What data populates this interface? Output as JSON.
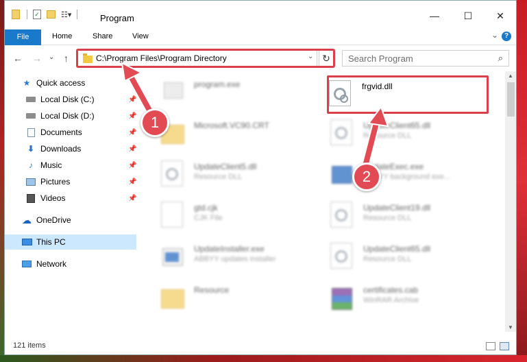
{
  "window": {
    "title": "Program",
    "minimize_glyph": "—",
    "maximize_glyph": "☐",
    "close_glyph": "✕"
  },
  "ribbon": {
    "tabs": [
      "File",
      "Home",
      "Share",
      "View"
    ],
    "expand_glyph": "⌄",
    "help_glyph": "?"
  },
  "address": {
    "path": "C:\\Program Files\\Program Directory",
    "refresh_glyph": "↻"
  },
  "search": {
    "placeholder": "Search Program"
  },
  "nav": {
    "back_glyph": "←",
    "forward_glyph": "→",
    "recent_glyph": "⌄",
    "up_glyph": "↑"
  },
  "sidebar": {
    "items": [
      {
        "label": "Quick access",
        "icon": "star-icon",
        "pinned": false
      },
      {
        "label": "Local Disk (C:)",
        "icon": "drive-icon",
        "pinned": true
      },
      {
        "label": "Local Disk (D:)",
        "icon": "drive-icon",
        "pinned": true
      },
      {
        "label": "Documents",
        "icon": "documents-icon",
        "pinned": true
      },
      {
        "label": "Downloads",
        "icon": "download-icon",
        "pinned": true
      },
      {
        "label": "Music",
        "icon": "music-icon",
        "pinned": true
      },
      {
        "label": "Pictures",
        "icon": "pictures-icon",
        "pinned": true
      },
      {
        "label": "Videos",
        "icon": "videos-icon",
        "pinned": true
      },
      {
        "label": "OneDrive",
        "icon": "cloud-icon",
        "pinned": false
      },
      {
        "label": "This PC",
        "icon": "computer-icon",
        "pinned": false,
        "selected": true
      },
      {
        "label": "Network",
        "icon": "network-icon",
        "pinned": false
      }
    ],
    "pin_glyph": "📌"
  },
  "files": [
    {
      "name": "program.exe",
      "desc": "",
      "icon": "exe-icon"
    },
    {
      "name": "frgvid.dll",
      "desc": "",
      "icon": "dll-icon",
      "highlighted": true
    },
    {
      "name": "Microsoft.VC90.CRT",
      "desc": "",
      "icon": "folder-icon"
    },
    {
      "name": "UpdateClient65.dll",
      "desc": "Resource DLL",
      "icon": "dll-icon"
    },
    {
      "name": "UpdateClient5.dll",
      "desc": "Resource DLL",
      "icon": "dll-icon"
    },
    {
      "name": "UpdateExec.exe",
      "desc": "ABBYY background exe...",
      "icon": "exe-icon"
    },
    {
      "name": "gtd.cjk",
      "desc": "CJK File",
      "icon": "file-icon"
    },
    {
      "name": "UpdateClient19.dll",
      "desc": "Resource DLL",
      "icon": "dll-icon"
    },
    {
      "name": "UpdateInstaller.exe",
      "desc": "ABBYY updates installer",
      "icon": "exe-icon"
    },
    {
      "name": "UpdateClient65.dll",
      "desc": "Resource DLL",
      "icon": "dll-icon"
    },
    {
      "name": "Resource",
      "desc": "",
      "icon": "folder-icon"
    },
    {
      "name": "certificates.cab",
      "desc": "WinRAR Archive",
      "icon": "archive-icon"
    }
  ],
  "status": {
    "items_count": "121 items"
  },
  "callouts": [
    {
      "label": "1"
    },
    {
      "label": "2"
    }
  ],
  "colors": {
    "accent": "#1979ca",
    "highlight": "#d9404a",
    "selected": "#cce8ff"
  }
}
